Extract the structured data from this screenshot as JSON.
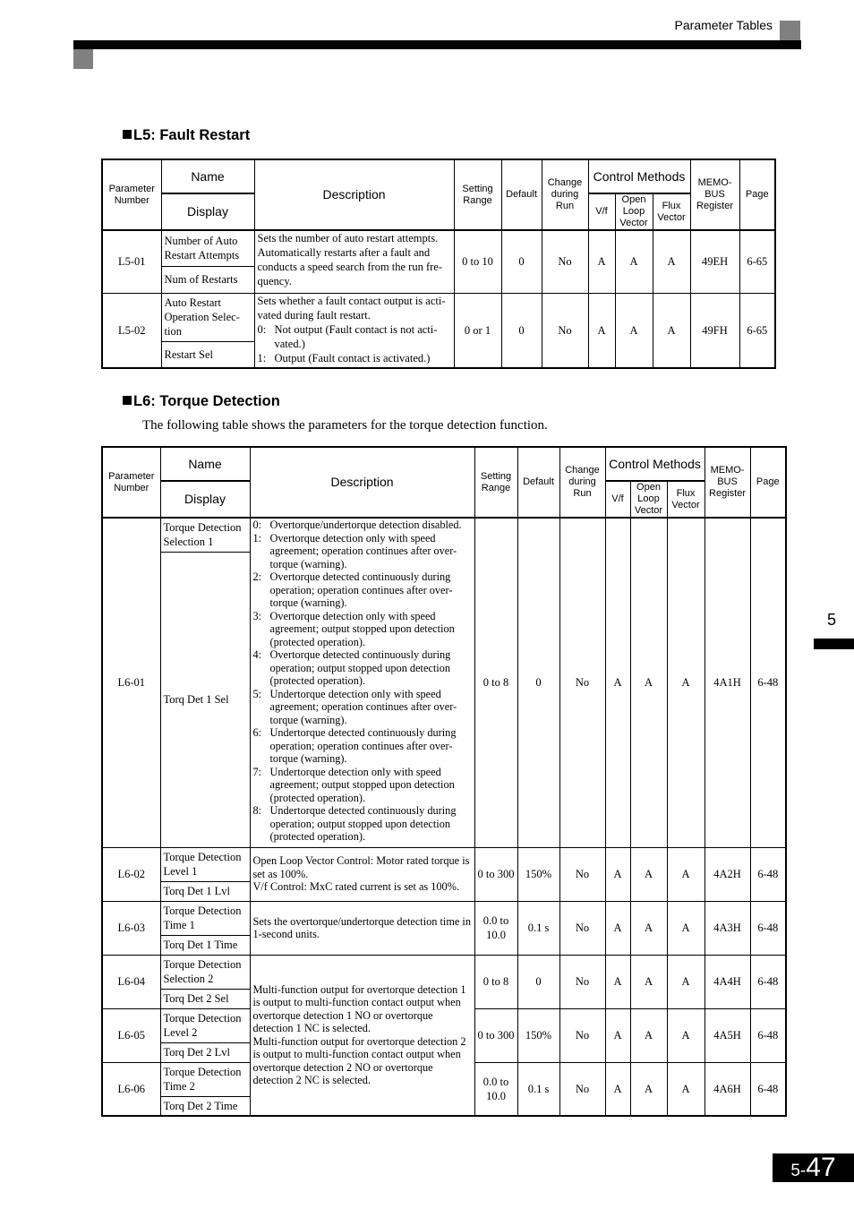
{
  "header": {
    "title": "Parameter Tables"
  },
  "side_tab": {
    "chapter": "5"
  },
  "page_number": {
    "chapter": "5-",
    "page": "47"
  },
  "columns": {
    "param_number": "Parameter Number",
    "name": "Name",
    "display": "Display",
    "description": "Description",
    "setting_range": "Setting Range",
    "default": "Default",
    "change_during_run": "Change during Run",
    "control_methods": "Control Methods",
    "vf": "V/f",
    "open_loop_vector": "Open Loop Vector",
    "flux_vector": "Flux Vector",
    "memobus": "MEMO-BUS Register",
    "page": "Page"
  },
  "l5": {
    "heading": "L5: Fault Restart",
    "rows": [
      {
        "param": "L5-01",
        "name": "Number of Auto Restart Attempts",
        "display": "Num of Restarts",
        "description": "Sets the number of auto restart attempts. Automatically restarts after a fault and conducts a speed search from the run fre-quency.",
        "range": "0 to 10",
        "default": "0",
        "change": "No",
        "vf": "A",
        "olv": "A",
        "fv": "A",
        "register": "49EH",
        "page": "6-65"
      },
      {
        "param": "L5-02",
        "name": "Auto Restart Operation Selec-tion",
        "display": "Restart Sel",
        "description_intro": "Sets whether a fault contact output is acti-vated during fault restart.",
        "options": [
          {
            "key": "0:",
            "text": "Not output (Fault contact is not acti-vated.)"
          },
          {
            "key": "1:",
            "text": "Output (Fault contact is activated.)"
          }
        ],
        "range": "0 or 1",
        "default": "0",
        "change": "No",
        "vf": "A",
        "olv": "A",
        "fv": "A",
        "register": "49FH",
        "page": "6-65"
      }
    ]
  },
  "l6": {
    "heading": "L6: Torque Detection",
    "intro": "The following table shows the parameters for the torque detection function.",
    "rows": [
      {
        "param": "L6-01",
        "name": "Torque Detection Selection 1",
        "display": "Torq Det 1 Sel",
        "options": [
          {
            "key": "0:",
            "text": "Overtorque/undertorque detection disabled."
          },
          {
            "key": "1:",
            "text": "Overtorque detection only with speed agreement; operation continues after over-torque (warning)."
          },
          {
            "key": "2:",
            "text": "Overtorque detected continuously during operation; operation continues after over-torque (warning)."
          },
          {
            "key": "3:",
            "text": "Overtorque detection only with speed agreement; output stopped upon detection (protected operation)."
          },
          {
            "key": "4:",
            "text": "Overtorque detected continuously during operation; output stopped upon detection (protected operation)."
          },
          {
            "key": "5:",
            "text": "Undertorque detection only with speed agreement; operation continues after over-torque (warning)."
          },
          {
            "key": "6:",
            "text": "Undertorque detected continuously during operation; operation continues after over-torque (warning)."
          },
          {
            "key": "7:",
            "text": "Undertorque detection only with speed agreement; output stopped upon detection (protected operation)."
          },
          {
            "key": "8:",
            "text": "Undertorque detected continuously during operation; output stopped upon detection (protected operation)."
          }
        ],
        "range": "0 to 8",
        "default": "0",
        "change": "No",
        "vf": "A",
        "olv": "A",
        "fv": "A",
        "register": "4A1H",
        "page": "6-48"
      },
      {
        "param": "L6-02",
        "name": "Torque Detection Level 1",
        "display": "Torq Det 1 Lvl",
        "description": "Open Loop Vector Control: Motor rated torque is set as 100%.",
        "description2": "V/f Control: MxC rated current is set as 100%.",
        "range": "0 to 300",
        "default": "150%",
        "change": "No",
        "vf": "A",
        "olv": "A",
        "fv": "A",
        "register": "4A2H",
        "page": "6-48"
      },
      {
        "param": "L6-03",
        "name": "Torque Detection Time 1",
        "display": "Torq Det 1 Time",
        "description": "Sets the overtorque/undertorque detection time in 1-second units.",
        "range": "0.0 to 10.0",
        "default": "0.1 s",
        "change": "No",
        "vf": "A",
        "olv": "A",
        "fv": "A",
        "register": "4A3H",
        "page": "6-48"
      },
      {
        "param": "L6-04",
        "name": "Torque Detection Selection 2",
        "display": "Torq Det 2 Sel",
        "range": "0 to 8",
        "default": "0",
        "change": "No",
        "vf": "A",
        "olv": "A",
        "fv": "A",
        "register": "4A4H",
        "page": "6-48"
      },
      {
        "param": "L6-05",
        "name": "Torque Detection Level 2",
        "display": "Torq Det 2 Lvl",
        "range": "0 to 300",
        "default": "150%",
        "change": "No",
        "vf": "A",
        "olv": "A",
        "fv": "A",
        "register": "4A5H",
        "page": "6-48"
      },
      {
        "param": "L6-06",
        "name": "Torque Detection Time 2",
        "display": "Torq Det 2 Time",
        "range": "0.0 to 10.0",
        "default": "0.1 s",
        "change": "No",
        "vf": "A",
        "olv": "A",
        "fv": "A",
        "register": "4A6H",
        "page": "6-48"
      }
    ],
    "shared_description_l6_04_06": [
      "Multi-function output for overtorque detection 1 is output to multi-function contact output when overtorque detection 1 NO or overtorque detection 1 NC is selected.",
      "Multi-function output for overtorque detection 2 is output to multi-function contact output when overtorque detection 2 NO or overtorque detection 2 NC is selected."
    ]
  }
}
